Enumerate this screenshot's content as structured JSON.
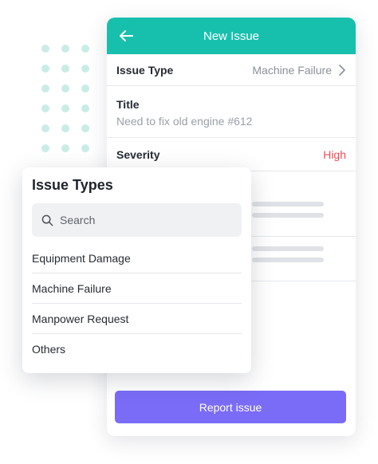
{
  "header": {
    "title": "New Issue"
  },
  "form": {
    "issue_type_label": "Issue Type",
    "issue_type_value": "Machine Failure",
    "title_label": "Title",
    "title_placeholder": "Need to fix old engine #612",
    "severity_label": "Severity",
    "severity_value": "High"
  },
  "report_button": {
    "label": "Report issue"
  },
  "dropdown": {
    "title": "Issue Types",
    "search_placeholder": "Search",
    "options": [
      "Equipment Damage",
      "Machine Failure",
      "Manpower Request",
      "Others"
    ]
  },
  "colors": {
    "header": "#17c0ad",
    "button": "#7a6cf6",
    "severity": "#f04a55"
  },
  "icons": {
    "back": "arrow-left-icon",
    "chevron": "chevron-right-icon",
    "search": "search-icon"
  }
}
